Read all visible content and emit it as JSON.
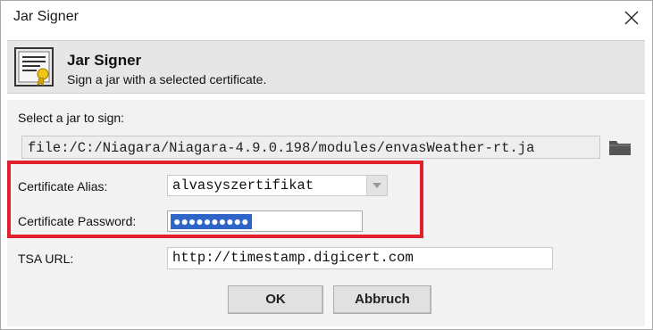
{
  "window": {
    "title": "Jar Signer"
  },
  "header": {
    "title": "Jar Signer",
    "subtitle": "Sign a jar with a selected certificate."
  },
  "jar": {
    "label": "Select a jar to sign:",
    "path": "file:/C:/Niagara/Niagara-4.9.0.198/modules/envasWeather-rt.ja"
  },
  "alias": {
    "label": "Certificate Alias:",
    "value": "alvasyszertifikat"
  },
  "password": {
    "label": "Certificate Password:",
    "masked": "●●●●●●●●●●"
  },
  "tsa": {
    "label": "TSA URL:",
    "value": "http://timestamp.digicert.com"
  },
  "buttons": {
    "ok": "OK",
    "cancel": "Abbruch"
  },
  "colors": {
    "highlight": "#e0202a",
    "selection": "#2f64c8"
  },
  "icons": {
    "close": "close-icon",
    "certificate": "certificate-icon",
    "folder": "folder-icon",
    "dropdown": "chevron-down-icon"
  }
}
